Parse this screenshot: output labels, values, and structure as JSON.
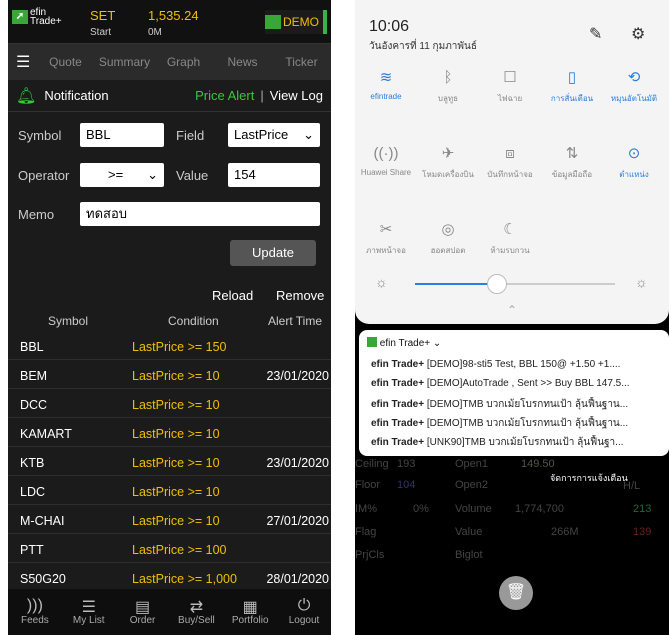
{
  "left": {
    "logo": "efin Trade+",
    "market": "SET",
    "market_sub": "Start",
    "index": "1,535.24",
    "volume": "0M",
    "demo": "DEMO",
    "nav": [
      "Quote",
      "Summary",
      "Graph",
      "News",
      "Ticker"
    ],
    "title": "Notification",
    "price_alert": "Price Alert",
    "sep": "|",
    "view_log": "View Log",
    "symbol_label": "Symbol",
    "symbol_value": "BBL",
    "field_label": "Field",
    "field_value": "LastPrice",
    "operator_label": "Operator",
    "operator_value": ">=",
    "value_label": "Value",
    "value_value": "154",
    "memo_label": "Memo",
    "memo_value": "ทดสอบ",
    "update": "Update",
    "reload": "Reload",
    "remove": "Remove",
    "col_symbol": "Symbol",
    "col_condition": "Condition",
    "col_time": "Alert Time",
    "rows": [
      {
        "sym": "BBL",
        "cond": "LastPrice >= 150",
        "dt": ""
      },
      {
        "sym": "BEM",
        "cond": "LastPrice >= 10",
        "dt": "23/01/2020"
      },
      {
        "sym": "DCC",
        "cond": "LastPrice >= 10",
        "dt": ""
      },
      {
        "sym": "KAMART",
        "cond": "LastPrice >= 10",
        "dt": ""
      },
      {
        "sym": "KTB",
        "cond": "LastPrice >= 10",
        "dt": "23/01/2020"
      },
      {
        "sym": "LDC",
        "cond": "LastPrice >= 10",
        "dt": ""
      },
      {
        "sym": "M-CHAI",
        "cond": "LastPrice >= 10",
        "dt": "27/01/2020"
      },
      {
        "sym": "PTT",
        "cond": "LastPrice >= 100",
        "dt": ""
      },
      {
        "sym": "S50G20",
        "cond": "LastPrice >= 1,000",
        "dt": "28/01/2020"
      }
    ],
    "footer": [
      "Feeds",
      "My List",
      "Order",
      "Buy/Sell",
      "Portfolio",
      "Logout"
    ]
  },
  "right": {
    "time": "10:06",
    "date": "วันอังคารที่ 11 กุมภาพันธ์",
    "quick": [
      {
        "label": "efintrade",
        "icon": "wifi-icon",
        "on": true
      },
      {
        "label": "บลูทูธ",
        "icon": "bluetooth-icon",
        "on": false
      },
      {
        "label": "ไฟฉาย",
        "icon": "flashlight-icon",
        "on": false
      },
      {
        "label": "การสั่นเตือน",
        "icon": "vibrate-icon",
        "on": true
      },
      {
        "label": "หมุนอัตโนมัติ",
        "icon": "rotate-icon",
        "on": true
      },
      {
        "label": "Huawei Share",
        "icon": "share-icon",
        "on": false
      },
      {
        "label": "โหมดเครื่องบิน",
        "icon": "airplane-icon",
        "on": false
      },
      {
        "label": "บันทึกหน้าจอ",
        "icon": "screen-record-icon",
        "on": false
      },
      {
        "label": "ข้อมูลมือถือ",
        "icon": "mobile-data-icon",
        "on": false
      },
      {
        "label": "ตำแหน่ง",
        "icon": "location-icon",
        "on": true
      },
      {
        "label": "ภาพหน้าจอ",
        "icon": "screenshot-icon",
        "on": false
      },
      {
        "label": "ฮอตสปอต",
        "icon": "hotspot-icon",
        "on": false
      },
      {
        "label": "ห้ามรบกวน",
        "icon": "dnd-icon",
        "on": false
      }
    ],
    "notif_app": "efin Trade+",
    "notifs": [
      [
        "efin Trade+",
        " [DEMO]98-sti5 Test, BBL  150@  +1.50 +1...."
      ],
      [
        "efin Trade+",
        " [DEMO]AutoTrade , Sent >> Buy BBL 147.5..."
      ],
      [
        "efin Trade+",
        " [DEMO]TMB บวกเม้ยโบรกทนเป้า ลุ้นฟื้นฐาน..."
      ],
      [
        "efin Trade+",
        " [DEMO]TMB บวกเม้ยโบรกทนเป้า ลุ้นฟื้นฐาน..."
      ],
      [
        "efin Trade+",
        " [UNK90]TMB บวกเม้ยโบรกทนเป้า ลุ้นฟื้นฐา..."
      ]
    ],
    "manage": "จัดการการแจ้งเตือน",
    "bg": {
      "ceiling": "Ceiling",
      "ceiling_v": "193",
      "open1": "Open1",
      "open1_v": "149.50",
      "floor": "Floor",
      "floor_v": "104",
      "open2": "Open2",
      "hl": "H/L",
      "im": "IM%",
      "im_v": "0%",
      "volume": "Volume",
      "volume_v": "1,774,700",
      "vol2": "213",
      "flag": "Flag",
      "value": "Value",
      "value_v": "266M",
      "value2": "139",
      "prjcls": "PrjCls",
      "biglot": "Biglot"
    }
  }
}
